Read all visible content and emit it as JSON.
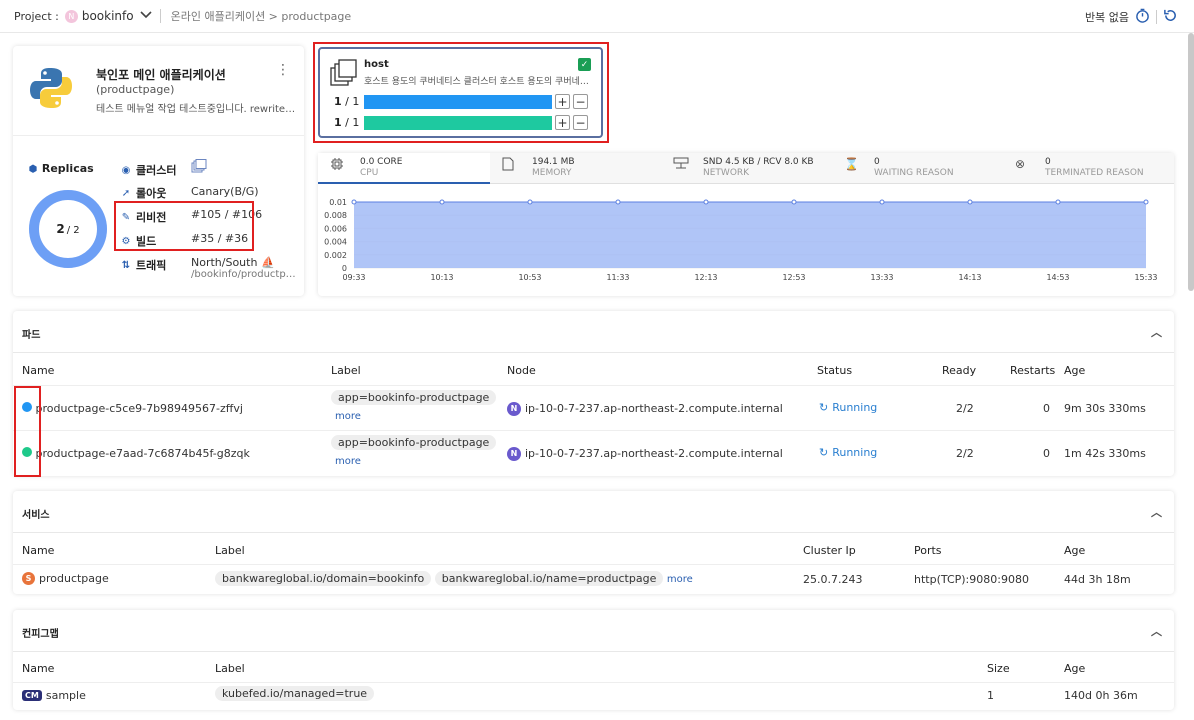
{
  "topbar": {
    "project_label": "Project :",
    "project_badge": "N",
    "project_name": "bookinfo",
    "breadcrumb": "온라인 애플리케이션 > productpage",
    "repeat_label": "반복 없음"
  },
  "app": {
    "title": "북인포 메인 애플리케이션",
    "subtitle": "(productpage)",
    "description": "테스트 메뉴얼 작업 테스트중입니다. rewrite…",
    "replicas_label": "Replicas",
    "replicas_ready": "2",
    "replicas_total": "/ 2",
    "replicas_fraction": 1.0,
    "info": [
      {
        "label": "클러스터",
        "value": ""
      },
      {
        "label": "롤아웃",
        "value": "Canary(B/G)"
      },
      {
        "label": "리비전",
        "value": "#105 / #106"
      },
      {
        "label": "빌드",
        "value": "#35 / #36"
      },
      {
        "label": "트래픽",
        "value": "North/South",
        "value2": "/bookinfo/productp…"
      }
    ]
  },
  "host": {
    "name": "host",
    "description": "호스트 용도의 쿠버네티스 클러스터 호스트 용도의 쿠버네…",
    "rows": [
      {
        "count": "1",
        "total": "/ 1",
        "color": "#2196f3"
      },
      {
        "count": "1",
        "total": "/ 1",
        "color": "#1ec9a0"
      }
    ]
  },
  "metrics": {
    "tabs": [
      {
        "value": "0.0 CORE",
        "label": "CPU",
        "icon": "cpu-icon"
      },
      {
        "value": "194.1 MB",
        "label": "MEMORY",
        "icon": "memory-icon"
      },
      {
        "value": "SND 4.5 KB / RCV 8.0 KB",
        "label": "NETWORK",
        "icon": "network-icon"
      },
      {
        "value": "0",
        "label": "WAITING REASON",
        "icon": "hourglass-icon"
      },
      {
        "value": "0",
        "label": "TERMINATED REASON",
        "icon": "terminated-icon"
      }
    ]
  },
  "chart_data": {
    "type": "area",
    "x": [
      "09:33",
      "10:13",
      "10:53",
      "11:33",
      "12:13",
      "12:53",
      "13:33",
      "14:13",
      "14:53",
      "15:33"
    ],
    "y_ticks": [
      "0.01",
      "0.008",
      "0.006",
      "0.004",
      "0.002",
      "0"
    ],
    "ylim": [
      0,
      0.01
    ],
    "series": [
      {
        "values": [
          0.01,
          0.01,
          0.01,
          0.01,
          0.01,
          0.01,
          0.01,
          0.01,
          0.01,
          0.01
        ]
      }
    ],
    "color": "#9cb6f5"
  },
  "pods": {
    "title": "파드",
    "headers": [
      "Name",
      "Label",
      "Node",
      "Status",
      "Ready",
      "Restarts",
      "Age"
    ],
    "rows": [
      {
        "name": "productpage-c5ce9-7b98949567-zffvj",
        "label": "app=bookinfo-productpage",
        "more": "more",
        "node_badge": "N",
        "node": "ip-10-0-7-237.ap-northeast-2.compute.internal",
        "status": "Running",
        "ready": "2/2",
        "restarts": "0",
        "age": "9m 30s 330ms",
        "color": "#2196f3"
      },
      {
        "name": "productpage-e7aad-7c6874b45f-g8zqk",
        "label": "app=bookinfo-productpage",
        "more": "more",
        "node_badge": "N",
        "node": "ip-10-0-7-237.ap-northeast-2.compute.internal",
        "status": "Running",
        "ready": "2/2",
        "restarts": "0",
        "age": "1m 42s 330ms",
        "color": "#1ec98a"
      }
    ]
  },
  "services": {
    "title": "서비스",
    "headers": [
      "Name",
      "Label",
      "Cluster Ip",
      "Ports",
      "Age"
    ],
    "rows": [
      {
        "badge": "S",
        "name": "productpage",
        "labels": [
          "bankwareglobal.io/domain=bookinfo",
          "bankwareglobal.io/name=productpage"
        ],
        "more": "more",
        "cluster_ip": "25.0.7.243",
        "ports": "http(TCP):9080:9080",
        "age": "44d 3h 18m"
      }
    ]
  },
  "configmaps": {
    "title": "컨피그맵",
    "headers": [
      "Name",
      "Label",
      "Size",
      "Age"
    ],
    "rows": [
      {
        "badge": "CM",
        "name": "sample",
        "label": "kubefed.io/managed=true",
        "size": "1",
        "age": "140d 0h 36m"
      }
    ]
  }
}
